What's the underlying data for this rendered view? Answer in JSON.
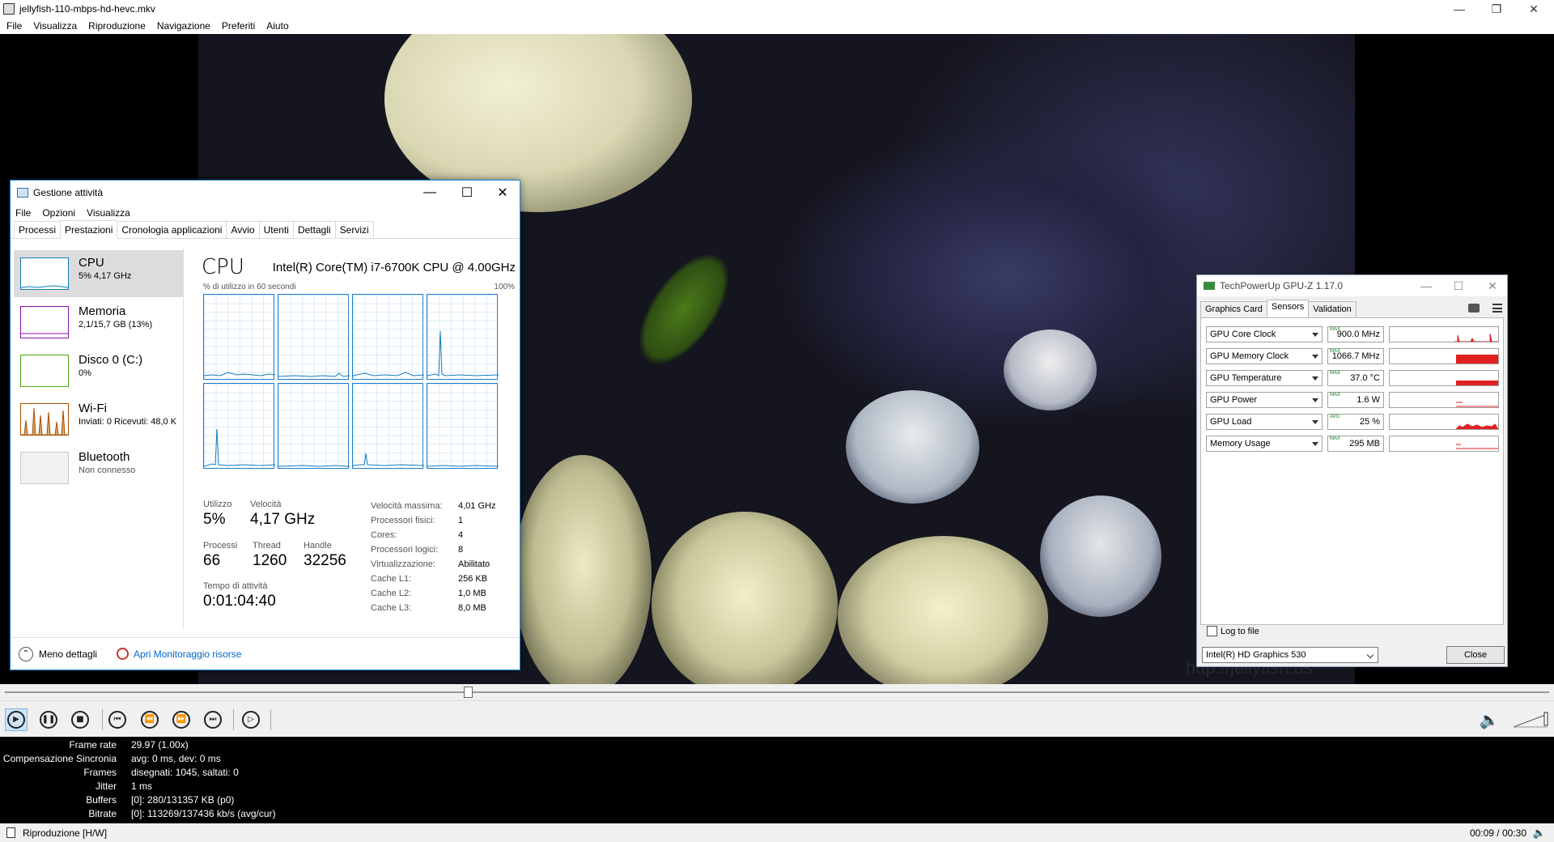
{
  "player": {
    "title": "jellyfish-110-mbps-hd-hevc.mkv",
    "menu": [
      "File",
      "Visualizza",
      "Riproduzione",
      "Navigazione",
      "Preferiti",
      "Aiuto"
    ],
    "watermark": "http://jellyfish.us",
    "seek_progress": 0.3,
    "stats": [
      {
        "label": "Frame rate",
        "value": "29.97 (1.00x)"
      },
      {
        "label": "Compensazione Sincronia",
        "value": "avg: 0 ms, dev: 0 ms"
      },
      {
        "label": "Frames",
        "value": "disegnati: 1045, saltati: 0"
      },
      {
        "label": "Jitter",
        "value": "1 ms"
      },
      {
        "label": "Buffers",
        "value": "[0]: 280/131357 KB (p0)"
      },
      {
        "label": "Bitrate",
        "value": "[0]: 113269/137436 kb/s (avg/cur)"
      }
    ],
    "status": "Riproduzione [H/W]",
    "time": "00:09 / 00:30"
  },
  "taskmgr": {
    "title": "Gestione attività",
    "menu": [
      "File",
      "Opzioni",
      "Visualizza"
    ],
    "tabs": [
      "Processi",
      "Prestazioni",
      "Cronologia applicazioni",
      "Avvio",
      "Utenti",
      "Dettagli",
      "Servizi"
    ],
    "resources": [
      {
        "name": "CPU",
        "sub": "5% 4,17 GHz",
        "color": "#117dbb"
      },
      {
        "name": "Memoria",
        "sub": "2,1/15,7 GB (13%)",
        "color": "#8b12ae"
      },
      {
        "name": "Disco 0 (C:)",
        "sub": "0%",
        "color": "#4da60c"
      },
      {
        "name": "Wi-Fi",
        "sub": "Inviati: 0 Ricevuti: 48,0 K",
        "color": "#a74f01"
      },
      {
        "name": "Bluetooth",
        "sub": "Non connesso",
        "color": "#a0a0a0"
      }
    ],
    "cpu": {
      "heading": "CPU",
      "model": "Intel(R) Core(TM) i7-6700K CPU @ 4.00GHz",
      "util_label": "% di utilizzo in 60 secondi",
      "util_max": "100%",
      "stats": {
        "utilizzo_label": "Utilizzo",
        "utilizzo": "5%",
        "velocita_label": "Velocità",
        "velocita": "4,17 GHz",
        "processi_label": "Processi",
        "processi": "66",
        "thread_label": "Thread",
        "thread": "1260",
        "handle_label": "Handle",
        "handle": "32256",
        "uptime_label": "Tempo di attività",
        "uptime": "0:01:04:40"
      },
      "specs": [
        {
          "k": "Velocità massima:",
          "v": "4,01 GHz"
        },
        {
          "k": "Processori fisici:",
          "v": "1"
        },
        {
          "k": "Cores:",
          "v": "4"
        },
        {
          "k": "Processori logici:",
          "v": "8"
        },
        {
          "k": "Virtualizzazione:",
          "v": "Abilitato"
        },
        {
          "k": "Cache L1:",
          "v": "256 KB"
        },
        {
          "k": "Cache L2:",
          "v": "1,0 MB"
        },
        {
          "k": "Cache L3:",
          "v": "8,0 MB"
        }
      ]
    },
    "footer": {
      "less": "Meno dettagli",
      "link": "Apri Monitoraggio risorse"
    }
  },
  "gpuz": {
    "title": "TechPowerUp GPU-Z 1.17.0",
    "tabs": [
      "Graphics Card",
      "Sensors",
      "Validation"
    ],
    "sensors": [
      {
        "name": "GPU Core Clock",
        "tag": "MAX",
        "value": "900.0 MHz"
      },
      {
        "name": "GPU Memory Clock",
        "tag": "MAX",
        "value": "1066.7 MHz"
      },
      {
        "name": "GPU Temperature",
        "tag": "MAX",
        "value": "37.0 °C"
      },
      {
        "name": "GPU Power",
        "tag": "MAX",
        "value": "1.6 W"
      },
      {
        "name": "GPU Load",
        "tag": "AVG",
        "value": "25 %"
      },
      {
        "name": "Memory Usage",
        "tag": "MAX",
        "value": "295 MB"
      }
    ],
    "log_label": "Log to file",
    "gpu_select": "Intel(R) HD Graphics 530",
    "close_label": "Close"
  }
}
